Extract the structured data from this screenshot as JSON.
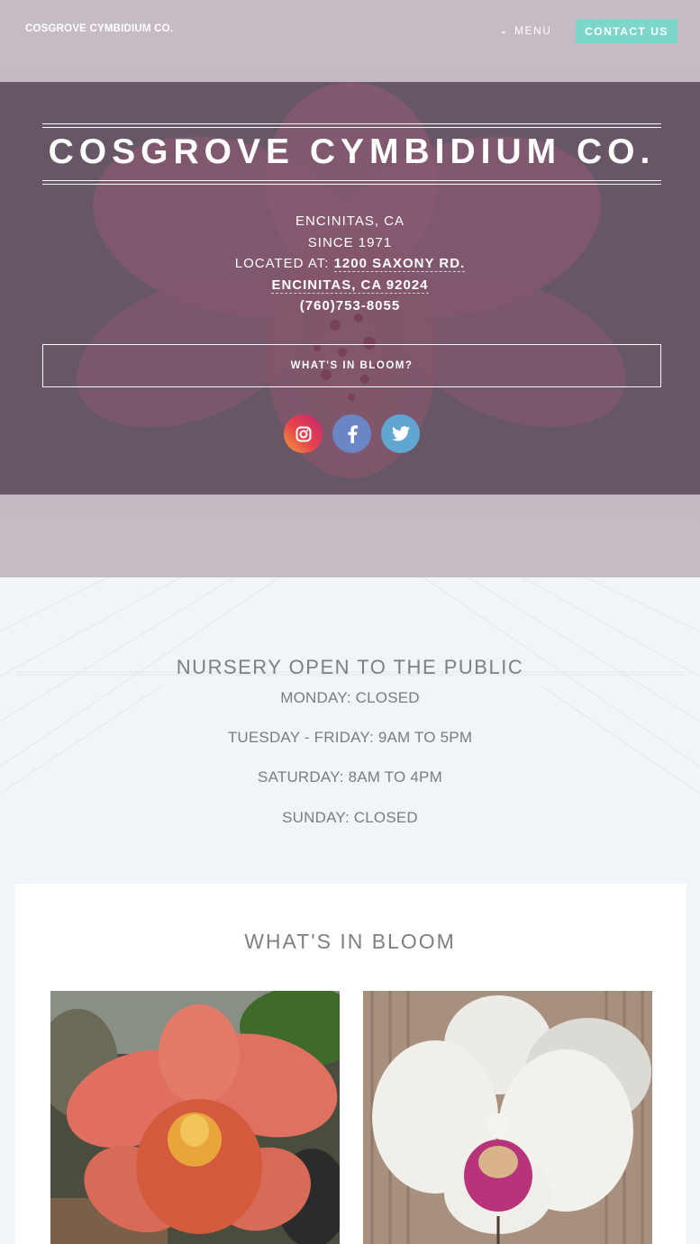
{
  "header": {
    "site_name": "COSGROVE CYMBIDIUM CO.",
    "menu_label": "MENU",
    "contact_label": "CONTACT US"
  },
  "hero": {
    "title": "COSGROVE CYMBIDIUM CO.",
    "location": "ENCINITAS, CA",
    "since": "SINCE 1971",
    "located_at_label": "LOCATED AT:",
    "address_line1": "1200 SAXONY RD.",
    "address_line2": "ENCINITAS, CA 92024",
    "phone": "(760)753-8055",
    "bloom_button": "WHAT'S IN BLOOM?",
    "social": [
      "instagram-icon",
      "facebook-icon",
      "twitter-icon"
    ]
  },
  "hours": {
    "title": "NURSERY OPEN TO THE PUBLIC",
    "lines": [
      "MONDAY: CLOSED",
      "TUESDAY - FRIDAY: 9AM TO 5PM",
      "SATURDAY: 8AM TO 4PM",
      "SUNDAY: CLOSED"
    ]
  },
  "bloom": {
    "title": "WHAT'S IN BLOOM"
  },
  "colors": {
    "accent": "#7cd6c9",
    "hero_overlay": "#6d5d6a",
    "page_bg": "#f1f4f8"
  }
}
